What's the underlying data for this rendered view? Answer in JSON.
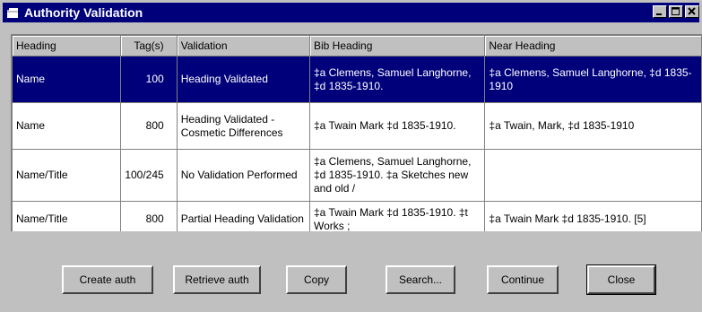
{
  "window": {
    "title": "Authority Validation"
  },
  "grid": {
    "columns": [
      "Heading",
      "Tag(s)",
      "Validation",
      "Bib Heading",
      "Near Heading"
    ],
    "rows": [
      {
        "heading": "Name",
        "tags": "100",
        "validation": "Heading Validated",
        "bib_heading": "‡a Clemens, Samuel Langhorne, ‡d 1835-1910.",
        "near_heading": "‡a Clemens, Samuel Langhorne, ‡d 1835-1910",
        "selected": true
      },
      {
        "heading": "Name",
        "tags": "800",
        "validation": "Heading Validated - Cosmetic Differences",
        "bib_heading": "‡a Twain Mark ‡d 1835-1910.",
        "near_heading": "‡a Twain, Mark, ‡d 1835-1910",
        "selected": false
      },
      {
        "heading": "Name/Title",
        "tags": "100/245",
        "validation": "No Validation Performed",
        "bib_heading": "‡a Clemens, Samuel Langhorne, ‡d 1835-1910. ‡a Sketches new and old /",
        "near_heading": "",
        "selected": false
      },
      {
        "heading": "Name/Title",
        "tags": "800",
        "validation": "Partial Heading Validation",
        "bib_heading": "‡a Twain Mark ‡d 1835-1910. ‡t Works ;",
        "near_heading": "‡a Twain Mark ‡d 1835-1910.  [5]",
        "selected": false
      }
    ]
  },
  "buttons": {
    "create_auth": "Create auth",
    "retrieve_auth": "Retrieve auth",
    "copy": "Copy",
    "search": "Search...",
    "continue": "Continue",
    "close": "Close"
  },
  "colors": {
    "titlebar": "#00007b",
    "selection": "#00007b",
    "face": "#c0c0c0"
  }
}
